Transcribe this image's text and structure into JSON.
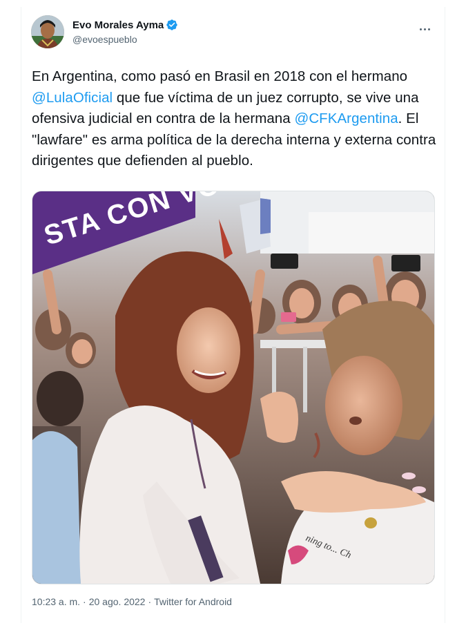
{
  "tweet": {
    "display_name": "Evo Morales Ayma",
    "handle": "@evoespueblo",
    "verified": true,
    "text_parts": [
      "En Argentina, como pasó en Brasil en 2018 con el hermano ",
      "@LulaOficial",
      " que fue víctima de un juez corrupto, se vive una ofensiva judicial en contra de la hermana ",
      "@CFKArgentina",
      ". El \"lawfare\" es arma política de la derecha interna y externa contra dirigentes que defienden al pueblo."
    ],
    "image_banner_text": "STA CON VOS",
    "image_shirt_text": "ning to... Ch",
    "time": "10:23 a. m.",
    "separator": "·",
    "date": "20 ago. 2022",
    "source": "Twitter for Android"
  },
  "colors": {
    "link": "#1d9bf0",
    "verified": "#1d9bf0",
    "muted": "#536471"
  },
  "icons": [
    "verified-badge-icon",
    "more-options-icon"
  ]
}
